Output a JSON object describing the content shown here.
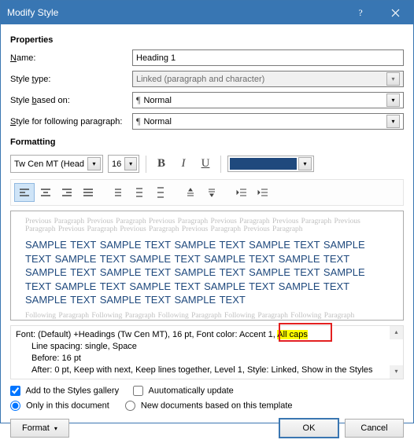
{
  "titlebar": {
    "title": "Modify Style"
  },
  "sections": {
    "properties": "Properties",
    "formatting": "Formatting"
  },
  "labels": {
    "name_pre": "",
    "name_u": "N",
    "name_post": "ame:",
    "styletype_pre": "Style ",
    "styletype_u": "t",
    "styletype_post": "ype:",
    "basedon_pre": "Style ",
    "basedon_u": "b",
    "basedon_post": "ased on:",
    "following_pre": "",
    "following_u": "S",
    "following_post": "tyle for following paragraph:"
  },
  "fields": {
    "name": "Heading 1",
    "style_type": "Linked (paragraph and character)",
    "based_on": "Normal",
    "following": "Normal"
  },
  "formatting": {
    "font_name": "Tw Cen MT (Headi",
    "font_size": "16"
  },
  "preview": {
    "prev_para": "Previous Paragraph Previous Paragraph Previous Paragraph Previous Paragraph Previous Paragraph Previous",
    "prev_para2": "Paragraph Previous Paragraph Previous Paragraph Previous Paragraph Previous Paragraph",
    "sample_line": "SAMPLE TEXT SAMPLE TEXT SAMPLE TEXT SAMPLE TEXT SAMPLE TEXT",
    "sample_last": "SAMPLE TEXT",
    "follow": "Following Paragraph Following Paragraph Following Paragraph Following Paragraph Following Paragraph"
  },
  "description": {
    "line1a": "Font: (Default) +Headings (Tw Cen MT), 16 pt, Font color: Accent 1, ",
    "line1b": "All caps",
    "line2": "Line spacing:  single, Space",
    "line3": "Before:  16 pt",
    "line4": "After:  0 pt, Keep with next, Keep lines together, Level 1, Style: Linked, Show in the Styles"
  },
  "options": {
    "add_gallery": "dd to the Styles gallery",
    "auto_update": "utomatically update",
    "only_doc": "Only in this ",
    "only_doc_u": "d",
    "only_doc_post": "ocument",
    "new_docs": "New documents based on this template"
  },
  "buttons": {
    "format": "F",
    "format_post": "ormat",
    "ok": "OK",
    "cancel": "Cancel"
  }
}
